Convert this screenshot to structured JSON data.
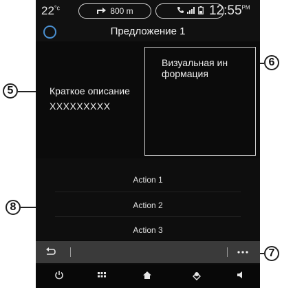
{
  "statusbar": {
    "temperature": "22",
    "temperature_unit": "°c",
    "nav_distance": "800 m",
    "nav_icon": "turn-right-arrow-icon",
    "phone_icons": "phone-signal-battery-icons",
    "time": "12:55",
    "time_suffix": "PM"
  },
  "header": {
    "title": "Предложение 1",
    "icon": "circle-icon"
  },
  "content": {
    "short_description_label": "Краткое описание",
    "short_description_value": "XXXXXXXXX",
    "visual_info": "Визуальная ин формация"
  },
  "actions": [
    "Action 1",
    "Action 2",
    "Action 3"
  ],
  "toolbar": {
    "back_icon": "back-arrow-icon",
    "more_icon": "more-options-icon"
  },
  "bottom_bar": {
    "icons": [
      "power-icon",
      "apps-grid-icon",
      "home-icon",
      "navigation-icon",
      "volume-icon"
    ]
  },
  "callouts": {
    "five": "5",
    "six": "6",
    "seven": "7",
    "eight": "8"
  },
  "colors": {
    "accent_circle": "#4a8fd0",
    "background": "#0b0b0b",
    "toolbar": "#3a3a3a"
  }
}
